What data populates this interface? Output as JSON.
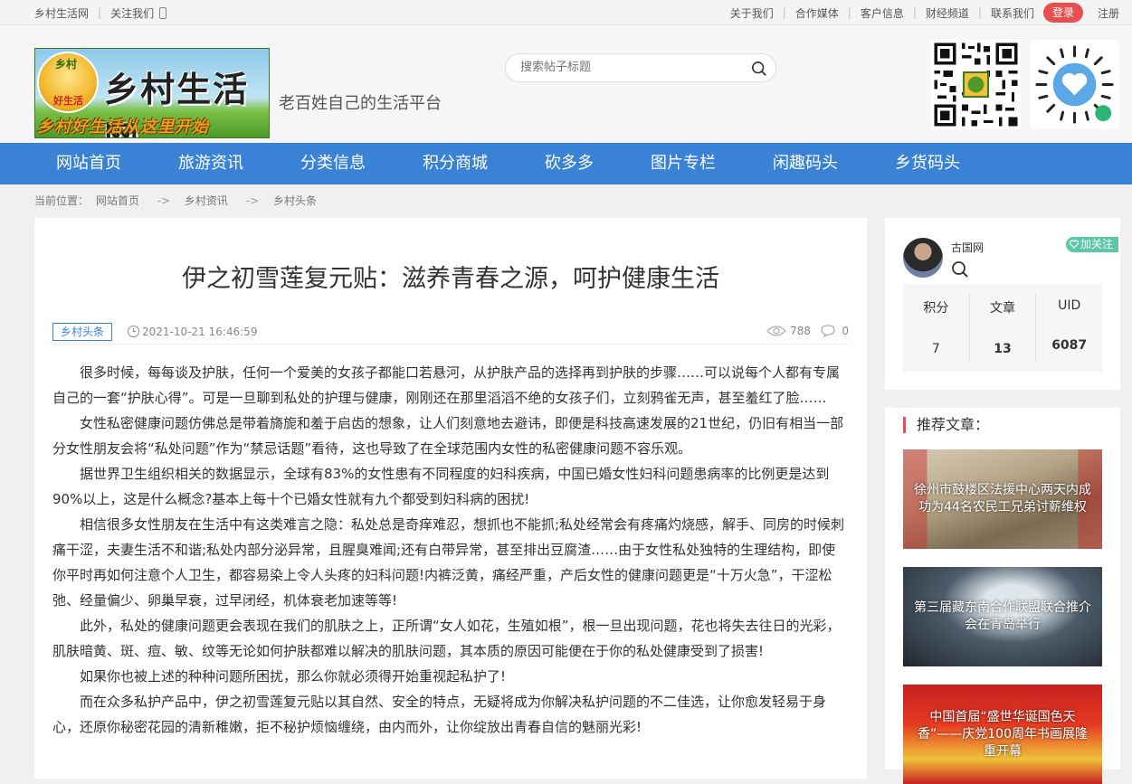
{
  "topbar": {
    "site_name": "乡村生活网",
    "follow_us": "关注我们",
    "links": [
      "关于我们",
      "合作媒体",
      "客户信息",
      "财经频道",
      "联系我们"
    ],
    "login": "登录",
    "register": "注册"
  },
  "header": {
    "logo_badge_top": "乡村",
    "logo_badge_bottom": "好生活",
    "logo_title": "乡村生活网",
    "logo_slogan": "乡村好生活从这里开始",
    "tagline": "老百姓自己的生活平台",
    "search_placeholder": "搜索帖子标题"
  },
  "nav": [
    "网站首页",
    "旅游资讯",
    "分类信息",
    "积分商城",
    "砍多多",
    "图片专栏",
    "闲趣码头",
    "乡货码头"
  ],
  "breadcrumb": {
    "label": "当前位置：",
    "items": [
      "网站首页",
      "乡村资讯",
      "乡村头条"
    ],
    "arrow": "->"
  },
  "article": {
    "title": "伊之初雪莲复元贴：滋养青春之源，呵护健康生活",
    "tag": "乡村头条",
    "date": "2021-10-21 16:46:59",
    "views": "788",
    "comments": "0",
    "paragraphs": [
      "很多时候，每每谈及护肤，任何一个爱美的女孩子都能口若悬河，从护肤产品的选择再到护肤的步骤……可以说每个人都有专属自己的一套“护肤心得”。可是一旦聊到私处的护理与健康，刚刚还在那里滔滔不绝的女孩子们，立刻鸦雀无声，甚至羞红了脸……",
      "女性私密健康问题仿佛总是带着旖旎和羞于启齿的想象，让人们刻意地去避讳，即便是科技高速发展的21世纪，仍旧有相当一部分女性朋友会将“私处问题”作为“禁忌话题”看待，这也导致了在全球范围内女性的私密健康问题不容乐观。",
      "据世界卫生组织相关的数据显示，全球有83%的女性患有不同程度的妇科疾病，中国已婚女性妇科问题患病率的比例更是达到90%以上，这是什么概念?基本上每十个已婚女性就有九个都受到妇科病的困扰!",
      "相信很多女性朋友在生活中有这类难言之隐：私处总是奇痒难忍，想抓也不能抓;私处经常会有疼痛灼烧感，解手、同房的时候刺痛干涩，夫妻生活不和谐;私处内部分泌异常，且腥臭难闻;还有白带异常，甚至排出豆腐渣……由于女性私处独特的生理结构，即使你平时再如何注意个人卫生，都容易染上令人头疼的妇科问题!内裤泛黄，痛经严重，产后女性的健康问题更是“十万火急”，干涩松弛、经量偏少、卵巢早衰，过早闭经，机体衰老加速等等!",
      "此外，私处的健康问题更会表现在我们的肌肤之上，正所谓“女人如花，生殖如根”，根一旦出现问题，花也将失去往日的光彩，肌肤暗黄、斑、痘、敏、纹等无论如何护肤都难以解决的肌肤问题，其本质的原因可能便在于你的私处健康受到了损害!",
      "如果你也被上述的种种问题所困扰，那么你就必须得开始重视起私护了!",
      "而在众多私护产品中，伊之初雪莲复元贴以其自然、安全的特点，无疑将成为你解决私护问题的不二佳选，让你愈发轻易于身心，还原你秘密花园的清新稚嫩，拒不秘护烦恼缠绕，由内而外，让你绽放出青春自信的魅丽光彩!"
    ]
  },
  "user": {
    "name": "古国网",
    "follow": "加关注",
    "stats": [
      {
        "label": "积分",
        "value": "7"
      },
      {
        "label": "文章",
        "value": "13"
      },
      {
        "label": "UID",
        "value": "6087"
      }
    ]
  },
  "recommend": {
    "title": "推荐文章：",
    "items": [
      "徐州市鼓楼区法援中心两天内成功为44名农民工兄弟讨薪维权",
      "第三届藏东南合作联盟联合推介会在青岛举行",
      "中国首届“盛世华诞国色天香”——庆党100周年书画展隆重开幕"
    ]
  },
  "icons": {
    "search": "search-icon",
    "clock": "clock-icon",
    "eye": "eye-icon",
    "comment": "comment-icon",
    "phone": "phone-icon",
    "heart": "heart-icon"
  },
  "colors": {
    "nav_bg": "#3a82d6",
    "login_bg": "#e84f4f",
    "follow_bg": "#5cc8a8",
    "tag_color": "#3a82d6"
  }
}
